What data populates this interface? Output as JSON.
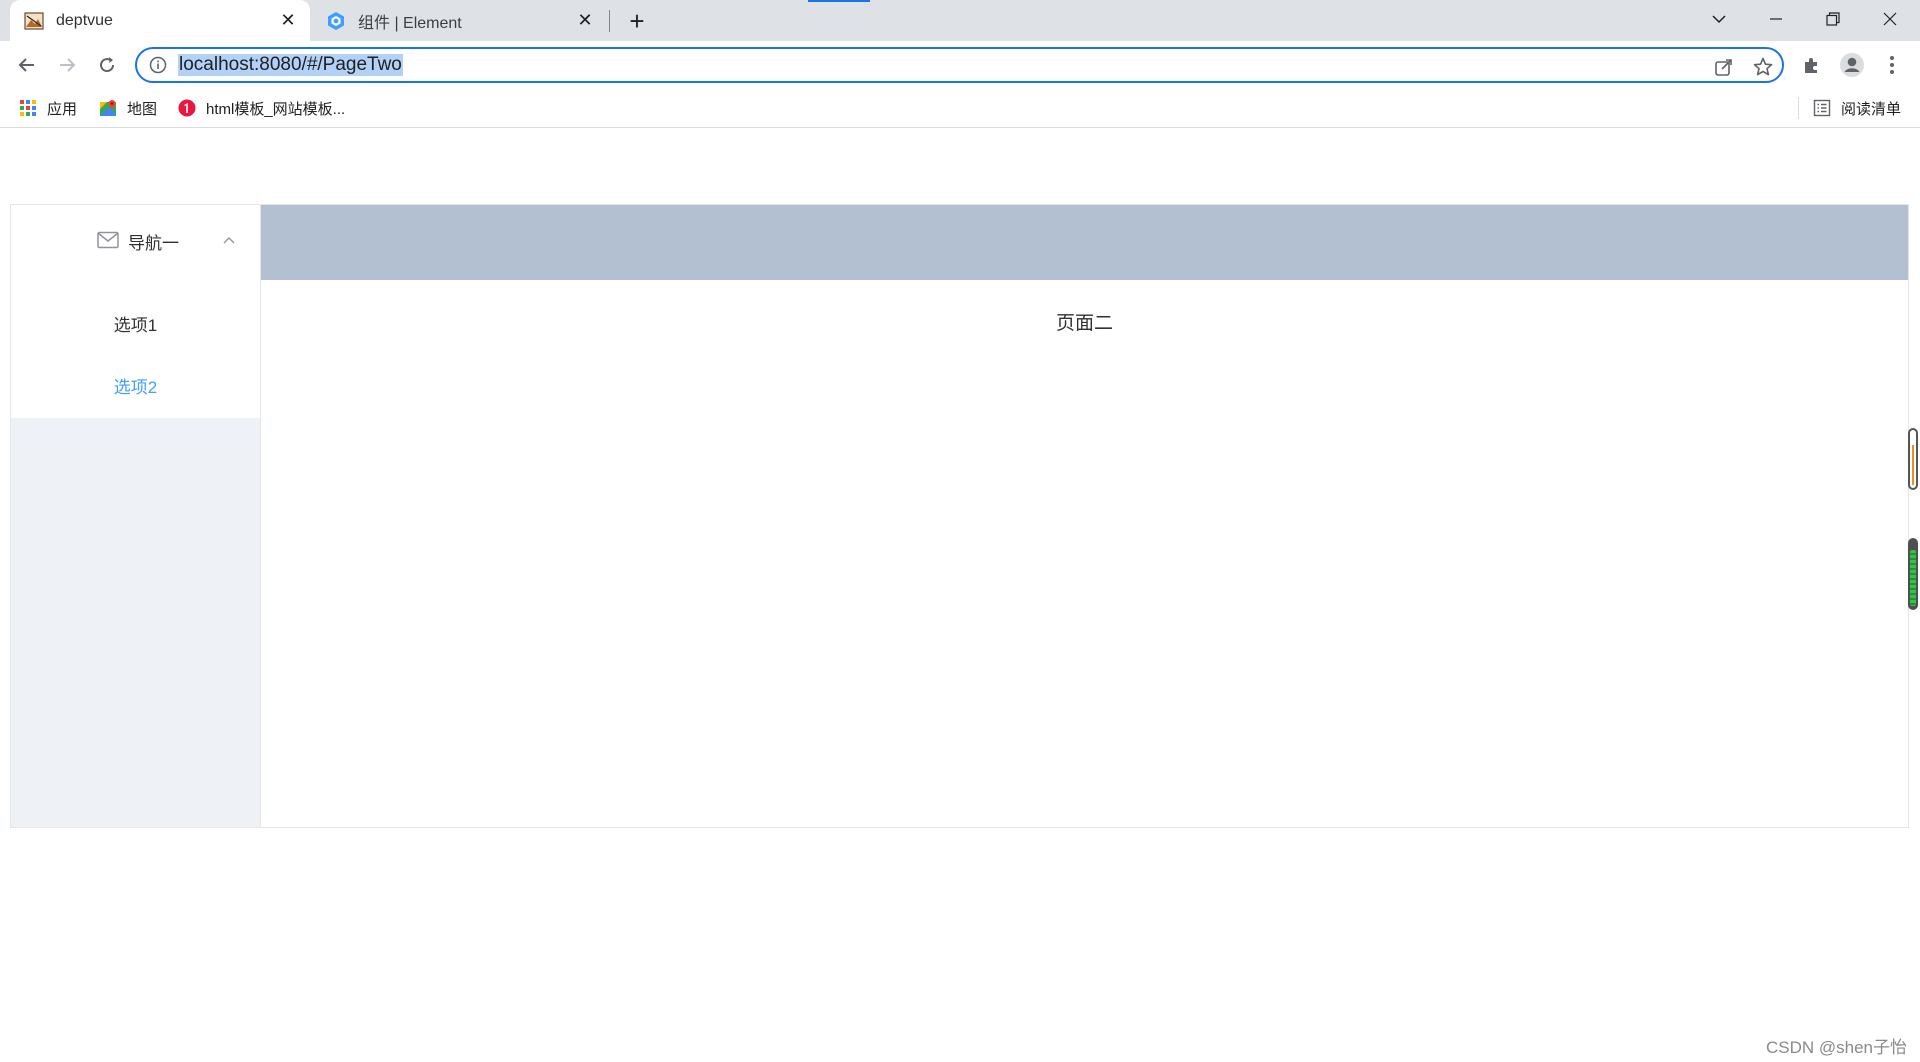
{
  "browser": {
    "tabs": [
      {
        "title": "deptvue",
        "active": true,
        "close_glyph": "✕"
      },
      {
        "title": "组件 | Element",
        "active": false,
        "close_glyph": "✕"
      }
    ],
    "new_tab_glyph": "+",
    "url": "localhost:8080/#/PageTwo",
    "window_controls": {
      "tab_search": "⌄",
      "minimize": "–",
      "restore": "❐",
      "close": "✕"
    }
  },
  "bookmarks": {
    "items": [
      {
        "label": "应用",
        "icon": "apps-grid-icon"
      },
      {
        "label": "地图",
        "icon": "maps-icon"
      },
      {
        "label": "html模板_网站模板...",
        "icon": "red-bookmark-icon"
      }
    ],
    "reading_list": "阅读清单"
  },
  "app": {
    "nav": {
      "group_title": "导航一",
      "group_icon": "mail-icon",
      "expanded": true,
      "items": [
        {
          "label": "选项1",
          "active": false
        },
        {
          "label": "选项2",
          "active": true
        }
      ],
      "active_color": "#409eff"
    },
    "header_color": "#b3c0d1",
    "main_text": "页面二",
    "aside_color": "#eef1f6"
  },
  "watermark": "CSDN @shen子怡"
}
